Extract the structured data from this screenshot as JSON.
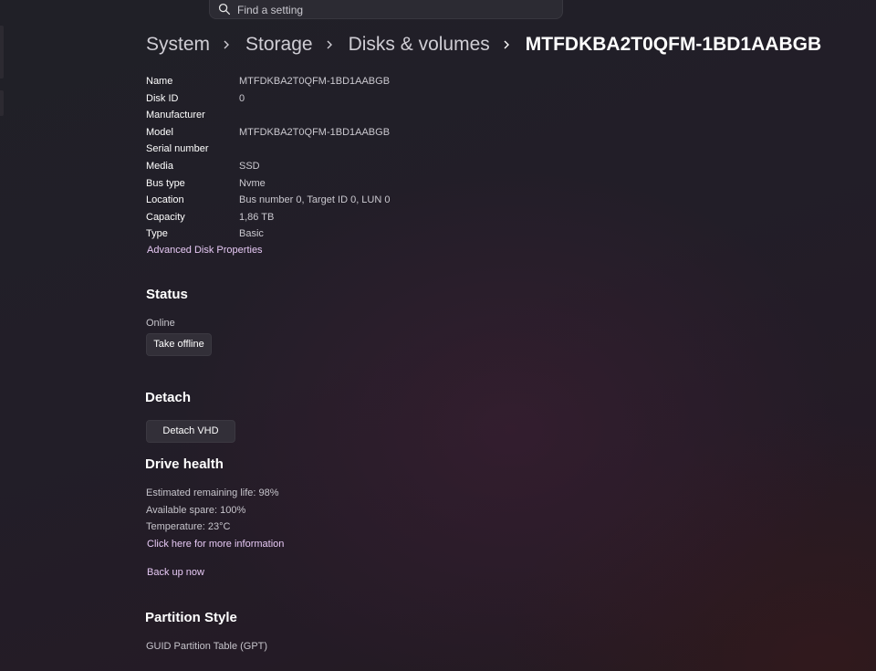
{
  "search": {
    "placeholder": "Find a setting",
    "icon": "search-icon"
  },
  "breadcrumb": {
    "items": [
      "System",
      "Storage",
      "Disks & volumes"
    ],
    "current": "MTFDKBA2T0QFM-1BD1AABGB"
  },
  "properties": [
    {
      "label": "Name",
      "value": "MTFDKBA2T0QFM-1BD1AABGB"
    },
    {
      "label": "Disk ID",
      "value": "0"
    },
    {
      "label": "Manufacturer",
      "value": ""
    },
    {
      "label": "Model",
      "value": "MTFDKBA2T0QFM-1BD1AABGB"
    },
    {
      "label": "Serial number",
      "value": ""
    },
    {
      "label": "Media",
      "value": "SSD"
    },
    {
      "label": "Bus type",
      "value": "Nvme"
    },
    {
      "label": "Location",
      "value": "Bus number 0, Target ID 0, LUN 0"
    },
    {
      "label": "Capacity",
      "value": "1,86 TB"
    },
    {
      "label": "Type",
      "value": "Basic"
    }
  ],
  "advanced_link": "Advanced Disk Properties",
  "status": {
    "title": "Status",
    "state": "Online",
    "button": "Take offline"
  },
  "detach": {
    "title": "Detach",
    "button": "Detach VHD"
  },
  "drive_health": {
    "title": "Drive health",
    "remaining_life": "Estimated remaining life: 98%",
    "available_spare": "Available spare: 100%",
    "temperature": "Temperature: 23°C",
    "more_info_link": "Click here for more information",
    "backup_link": "Back up now"
  },
  "partition_style": {
    "title": "Partition Style",
    "value": "GUID Partition Table (GPT)"
  },
  "colors": {
    "link": "#e6c8f4",
    "background": "#221e28",
    "button": "#322f38"
  }
}
